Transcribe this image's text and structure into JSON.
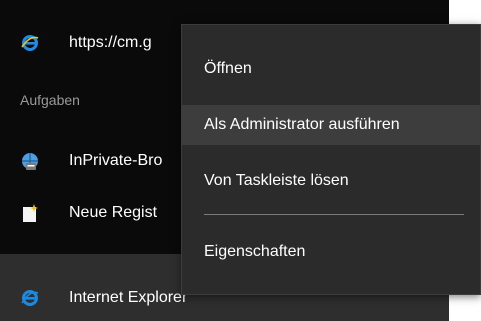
{
  "jumplist": {
    "pinned_item": {
      "label": "https://cm.g",
      "icon": "internet-explorer-icon"
    },
    "tasks_header": "Aufgaben",
    "tasks": [
      {
        "label": "InPrivate-Bro",
        "icon": "inprivate-icon"
      },
      {
        "label": "Neue Regist",
        "icon": "new-tab-icon"
      }
    ],
    "taskbar_item": {
      "label": "Internet Explorer",
      "icon": "internet-explorer-icon"
    }
  },
  "context_menu": {
    "items": [
      {
        "label": "Öffnen"
      },
      {
        "label": "Als Administrator ausführen"
      },
      {
        "label": "Von Taskleiste lösen"
      },
      {
        "label": "Eigenschaften"
      }
    ]
  },
  "colors": {
    "jumplist_bg": "#0a0a0a",
    "menu_bg": "#2b2b2b",
    "menu_hover": "#3d3d3d",
    "ie_blue": "#1a8be0"
  }
}
